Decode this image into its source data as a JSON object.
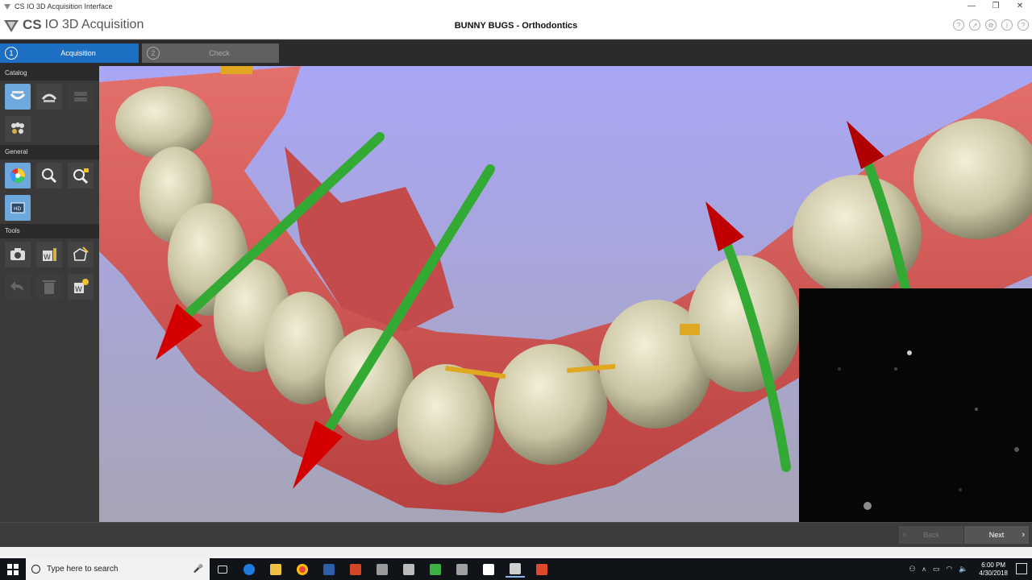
{
  "window": {
    "title": "CS IO 3D Acquisition Interface",
    "controls": [
      "—",
      "❐",
      "✕"
    ]
  },
  "header": {
    "logo_cs": "CS",
    "logo_rest": "IO 3D Acquisition",
    "patient_title": "BUNNY BUGS - Orthodontics",
    "icons": [
      "help-icon",
      "export-icon",
      "settings-icon",
      "info-icon",
      "question-icon"
    ]
  },
  "steps": [
    {
      "num": "1",
      "label": "Acquisition",
      "active": true
    },
    {
      "num": "2",
      "label": "Check",
      "active": false
    }
  ],
  "sidebar": {
    "catalog_label": "Catalog",
    "general_label": "General",
    "tools_label": "Tools"
  },
  "nav": {
    "back_label": "Back",
    "next_label": "Next"
  },
  "taskbar": {
    "search_placeholder": "Type here to search",
    "time": "6:00 PM",
    "date": "4/30/2018"
  },
  "colors": {
    "accent": "#1d6fc4",
    "viewport_bg_top": "#a7a4f2",
    "viewport_bg_bottom": "#a8a6b8",
    "gum": "#d9625f",
    "tooth": "#cdc8a8",
    "axis_green": "#3cb43c",
    "axis_red": "#d40000"
  }
}
